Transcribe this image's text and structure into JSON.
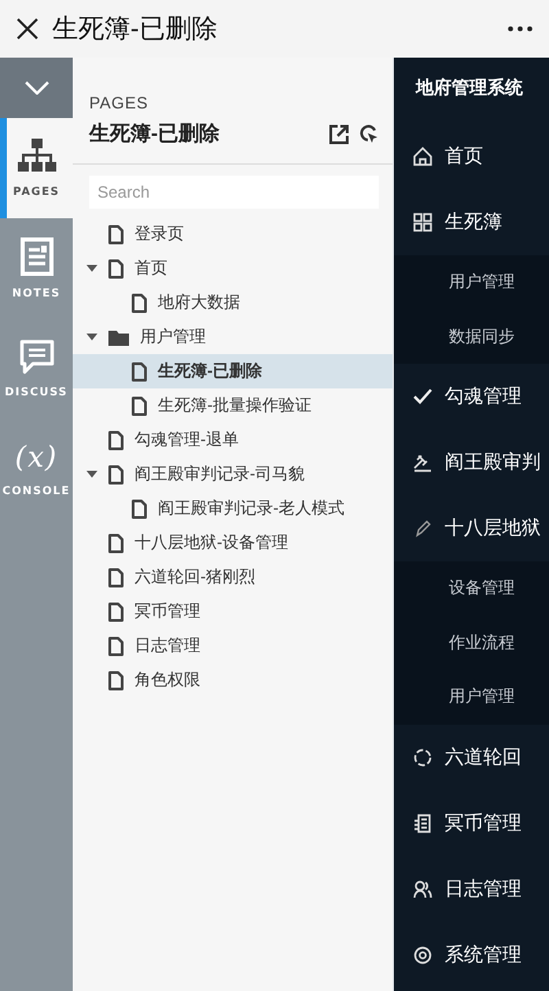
{
  "window": {
    "title": "生死簿-已删除"
  },
  "rail": {
    "items": [
      {
        "label": "PAGES",
        "selected": true
      },
      {
        "label": "NOTES",
        "selected": false
      },
      {
        "label": "DISCUSS",
        "selected": false
      },
      {
        "label": "CONSOLE",
        "selected": false,
        "glyph": "(x)"
      }
    ]
  },
  "pages_panel": {
    "heading": "PAGES",
    "title": "生死簿-已删除",
    "search": {
      "placeholder": "Search"
    },
    "tree": [
      {
        "label": "登录页",
        "kind": "page",
        "selected": false
      },
      {
        "label": "首页",
        "kind": "page",
        "selected": false,
        "expanded": true,
        "children": [
          {
            "label": "地府大数据",
            "kind": "page",
            "selected": false
          }
        ]
      },
      {
        "label": "用户管理",
        "kind": "folder",
        "selected": false,
        "expanded": true,
        "children": [
          {
            "label": "生死簿-已删除",
            "kind": "page",
            "selected": true
          },
          {
            "label": "生死簿-批量操作验证",
            "kind": "page",
            "selected": false
          }
        ]
      },
      {
        "label": "勾魂管理-退单",
        "kind": "page",
        "selected": false
      },
      {
        "label": "阎王殿审判记录-司马貌",
        "kind": "page",
        "selected": false,
        "expanded": true,
        "children": [
          {
            "label": "阎王殿审判记录-老人模式",
            "kind": "page",
            "selected": false
          }
        ]
      },
      {
        "label": "十八层地狱-设备管理",
        "kind": "page",
        "selected": false
      },
      {
        "label": "六道轮回-猪刚烈",
        "kind": "page",
        "selected": false
      },
      {
        "label": "冥币管理",
        "kind": "page",
        "selected": false
      },
      {
        "label": "日志管理",
        "kind": "page",
        "selected": false
      },
      {
        "label": "角色权限",
        "kind": "page",
        "selected": false
      }
    ]
  },
  "nav_menu": {
    "title": "地府管理系统",
    "items": [
      {
        "label": "首页"
      },
      {
        "label": "生死簿",
        "children": [
          {
            "label": "用户管理"
          },
          {
            "label": "数据同步"
          }
        ]
      },
      {
        "label": "勾魂管理"
      },
      {
        "label": "阎王殿审判"
      },
      {
        "label": "十八层地狱",
        "children": [
          {
            "label": "设备管理"
          },
          {
            "label": "作业流程"
          },
          {
            "label": "用户管理"
          }
        ]
      },
      {
        "label": "六道轮回"
      },
      {
        "label": "冥币管理"
      },
      {
        "label": "日志管理"
      },
      {
        "label": "系统管理"
      }
    ]
  }
}
